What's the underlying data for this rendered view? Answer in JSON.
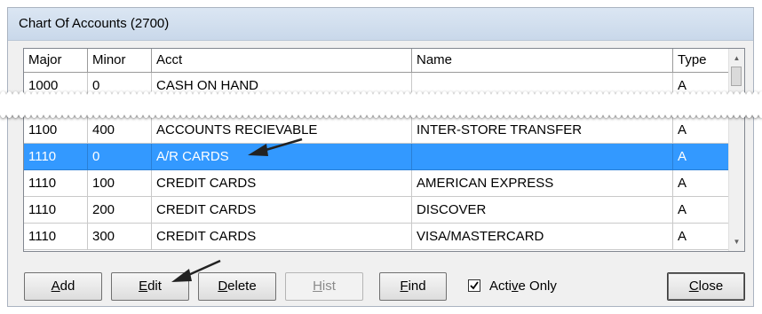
{
  "window": {
    "title": "Chart Of Accounts (2700)"
  },
  "grid": {
    "columns": [
      "Major",
      "Minor",
      "Acct",
      "Name",
      "Type"
    ],
    "top_row": {
      "major": "1000",
      "minor": "0",
      "acct": "CASH ON HAND",
      "name": "",
      "type": "A"
    },
    "rows": [
      {
        "major": "1100",
        "minor": "400",
        "acct": "ACCOUNTS RECIEVABLE",
        "name": "INTER-STORE TRANSFER",
        "type": "A",
        "selected": false
      },
      {
        "major": "1110",
        "minor": "0",
        "acct": "A/R CARDS",
        "name": "",
        "type": "A",
        "selected": true
      },
      {
        "major": "1110",
        "minor": "100",
        "acct": "CREDIT CARDS",
        "name": "AMERICAN EXPRESS",
        "type": "A",
        "selected": false
      },
      {
        "major": "1110",
        "minor": "200",
        "acct": "CREDIT CARDS",
        "name": "DISCOVER",
        "type": "A",
        "selected": false
      },
      {
        "major": "1110",
        "minor": "300",
        "acct": "CREDIT CARDS",
        "name": "VISA/MASTERCARD",
        "type": "A",
        "selected": false
      }
    ]
  },
  "buttons": {
    "add": {
      "pre": "",
      "key": "A",
      "post": "dd"
    },
    "edit": {
      "pre": "",
      "key": "E",
      "post": "dit"
    },
    "delete": {
      "pre": "",
      "key": "D",
      "post": "elete"
    },
    "hist": {
      "pre": "",
      "key": "H",
      "post": "ist"
    },
    "find": {
      "pre": "",
      "key": "F",
      "post": "ind"
    },
    "close": {
      "pre": "",
      "key": "C",
      "post": "lose"
    }
  },
  "active_only": {
    "pre": "Acti",
    "key": "v",
    "post": "e Only",
    "checked": true
  },
  "colors": {
    "selection": "#3399ff",
    "titlebar": "#c9d8ea"
  },
  "icons": [
    "scroll-up-icon",
    "scroll-down-icon",
    "check-icon",
    "arrow-pointer-icon"
  ]
}
